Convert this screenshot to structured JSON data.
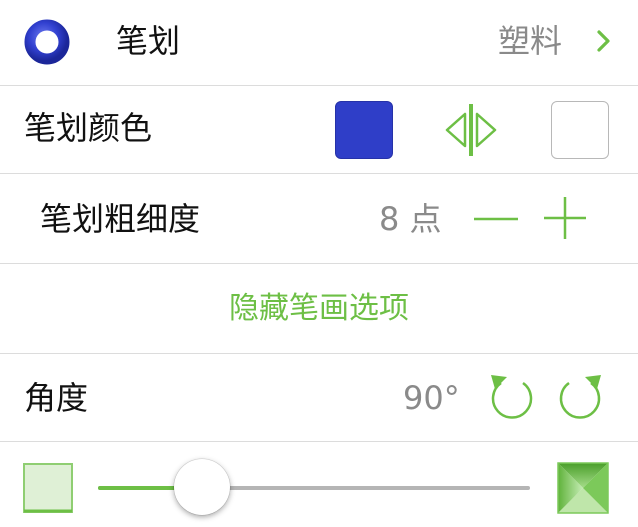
{
  "stroke": {
    "label": "笔划",
    "style_value": "塑料",
    "icon": "ring-icon",
    "chevron_icon": "chevron-right-icon"
  },
  "stroke_color": {
    "label": "笔划颜色",
    "primary_color": "#2f3ec8",
    "secondary_color": "#ffffff",
    "swap_icon": "swap-colors-icon"
  },
  "stroke_width": {
    "label": "笔划粗细度",
    "value": "8 点",
    "decrease_icon": "minus-icon",
    "increase_icon": "plus-icon"
  },
  "hide_options": {
    "label": "隐藏笔画选项"
  },
  "angle": {
    "label": "角度",
    "value": "90°",
    "rotate_ccw_icon": "rotate-counterclockwise-icon",
    "rotate_cw_icon": "rotate-clockwise-icon"
  },
  "shape_slider": {
    "value_fraction": 0.24,
    "min_icon": "square-shape-icon",
    "max_icon": "pyramid-shape-icon",
    "accent_color": "#6dbf45"
  }
}
